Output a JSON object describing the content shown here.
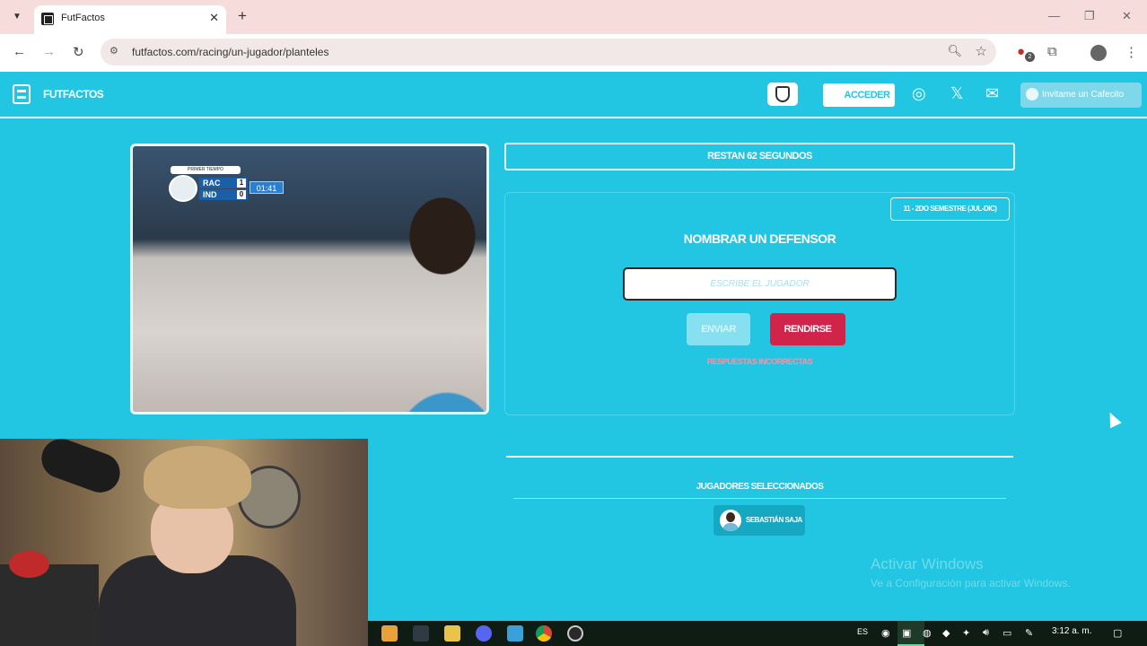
{
  "browser": {
    "tab_title": "FutFactos",
    "tab_close": "✕",
    "new_tab": "+",
    "url": "futfactos.com/racing/un-jugador/planteles",
    "extension_badge": "2"
  },
  "header": {
    "logo_text": "FUTFACTOS",
    "login_label": "ACCEDER",
    "cafecito_label": "Invitame un Cafecito"
  },
  "video": {
    "period_label": "PRIMER TIEMPO",
    "home_team": "RAC",
    "home_score": "1",
    "away_team": "IND",
    "away_score": "0",
    "clock": "01:41"
  },
  "game": {
    "timer_text": "RESTAN 62 SEGUNDOS",
    "period_badge": "11 - 2DO SEMESTRE (JUL-DIC)",
    "question": "NOMBRAR UN DEFENSOR",
    "input_placeholder": "ESCRIBE EL JUGADOR",
    "submit_label": "ENVIAR",
    "giveup_label": "RENDIRSE",
    "errors_label": "RESPUESTAS INCORRECTAS"
  },
  "selected": {
    "title": "JUGADORES SELECCIONADOS",
    "players": [
      {
        "name": "SEBASTIÁN SAJA"
      }
    ]
  },
  "watermark": {
    "title": "Activar Windows",
    "subtitle": "Ve a Configuración para activar Windows."
  },
  "taskbar": {
    "language": "ES",
    "time": "3:12 a. m."
  },
  "colors": {
    "page_bg": "#22c6e2",
    "giveup_red": "#d0244a",
    "tab_strip": "#f7dcdc"
  }
}
